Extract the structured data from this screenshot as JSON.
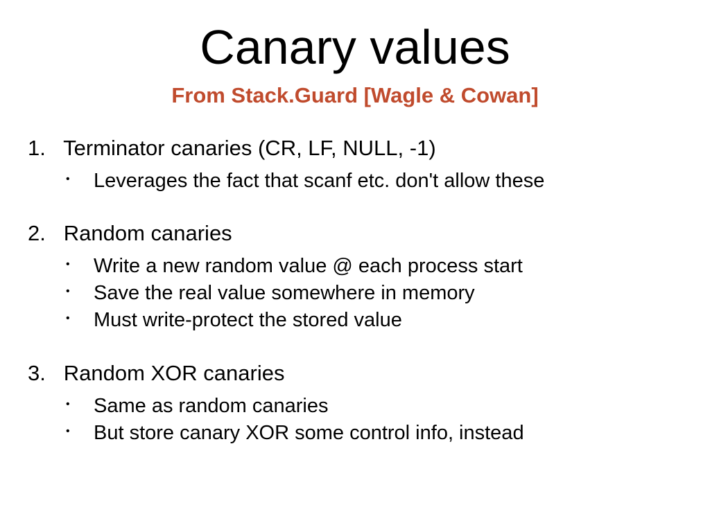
{
  "title": "Canary values",
  "subtitle": "From Stack.Guard [Wagle & Cowan]",
  "items": [
    {
      "heading": "Terminator canaries (CR, LF, NULL, -1)",
      "bullets": [
        "Leverages the fact that scanf etc. don't allow these"
      ]
    },
    {
      "heading": "Random canaries",
      "bullets": [
        "Write a new random value @ each process start",
        "Save the real value somewhere in memory",
        "Must write-protect the stored value"
      ]
    },
    {
      "heading": "Random XOR canaries",
      "bullets": [
        "Same as random canaries",
        "But store canary XOR some control info, instead"
      ]
    }
  ]
}
